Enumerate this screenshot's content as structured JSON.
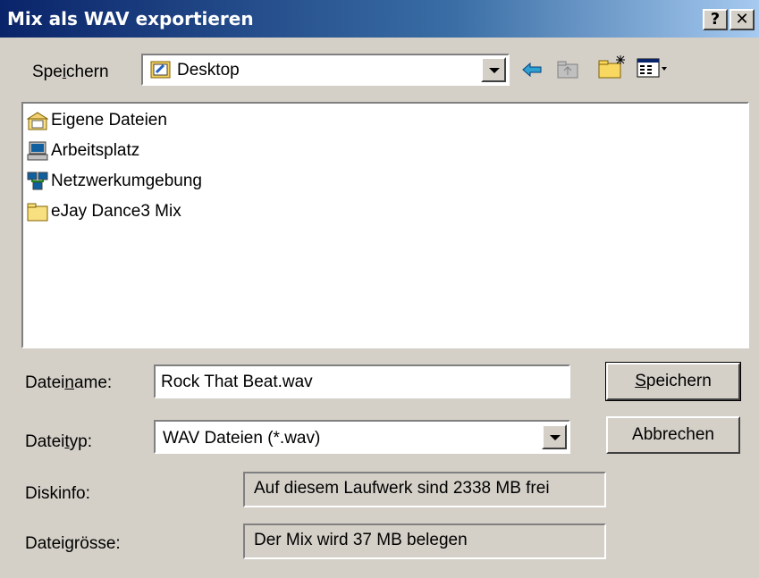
{
  "window": {
    "title": "Mix als WAV exportieren",
    "help_label": "?",
    "close_label": "✕"
  },
  "save_in": {
    "label_pre": "Spe",
    "label_u": "i",
    "label_post": "chern",
    "value": "Desktop"
  },
  "toolbar": [
    "back-icon",
    "up-folder-icon",
    "new-folder-icon",
    "view-menu-icon"
  ],
  "files": [
    {
      "name": "Eigene Dateien",
      "icon": "my-documents-icon"
    },
    {
      "name": "Arbeitsplatz",
      "icon": "my-computer-icon"
    },
    {
      "name": "Netzwerkumgebung",
      "icon": "network-icon"
    },
    {
      "name": "eJay Dance3  Mix",
      "icon": "folder-icon"
    }
  ],
  "filename": {
    "label_pre": "Datei",
    "label_u": "n",
    "label_post": "ame:",
    "value": "Rock That Beat.wav"
  },
  "filetype": {
    "label_pre": "Datei",
    "label_u": "t",
    "label_post": "yp:",
    "value": "WAV Dateien (*.wav)"
  },
  "diskinfo": {
    "label": "Diskinfo:",
    "value": "Auf diesem Laufwerk sind  2338 MB frei"
  },
  "filesize": {
    "label": "Dateigrösse:",
    "value": "Der Mix wird 37 MB belegen"
  },
  "buttons": {
    "save_u": "S",
    "save_rest": "peichern",
    "cancel": "Abbrechen"
  }
}
